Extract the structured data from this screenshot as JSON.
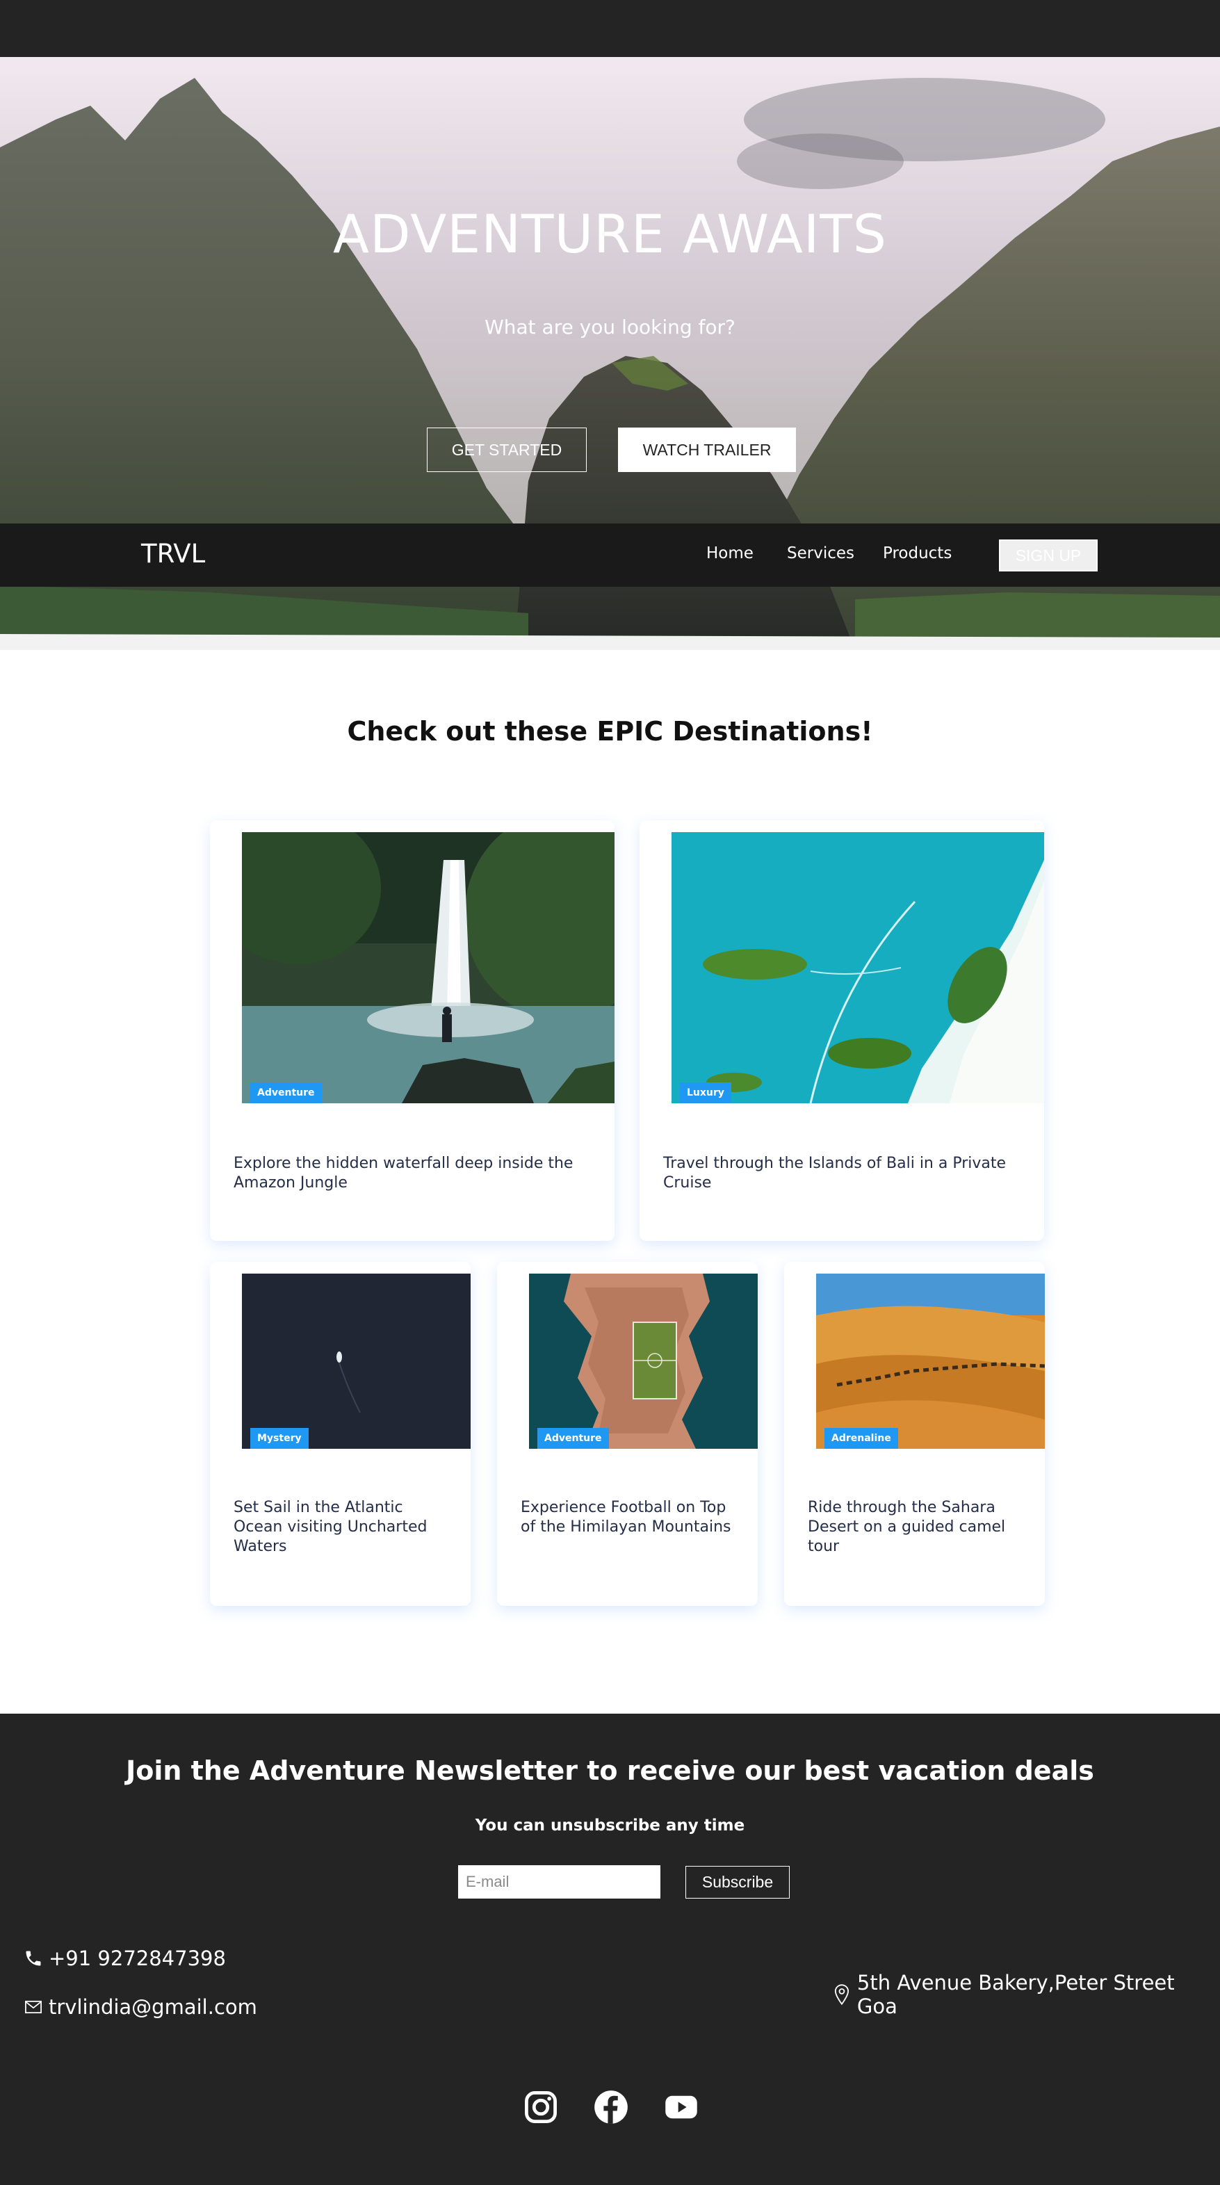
{
  "hero": {
    "title": "ADVENTURE AWAITS",
    "subtitle": "What are you looking for?",
    "primary_button": "GET STARTED",
    "secondary_button": "WATCH TRAILER"
  },
  "navbar": {
    "brand": "TRVL",
    "links": [
      "Home",
      "Services",
      "Products"
    ],
    "signup": "SIGN UP"
  },
  "destinations": {
    "title": "Check out these EPIC Destinations!",
    "cards": [
      {
        "tag": "Adventure",
        "text": "Explore the hidden waterfall deep inside the Amazon Jungle",
        "image": "waterfall-image"
      },
      {
        "tag": "Luxury",
        "text": "Travel through the Islands of Bali in a Private Cruise",
        "image": "bali-islands-image"
      },
      {
        "tag": "Mystery",
        "text": "Set Sail in the Atlantic Ocean visiting Uncharted Waters",
        "image": "ocean-boat-image"
      },
      {
        "tag": "Adventure",
        "text": "Experience Football on Top of the Himilayan Mountains",
        "image": "football-field-image"
      },
      {
        "tag": "Adrenaline",
        "text": "Ride through the Sahara Desert on a guided camel tour",
        "image": "desert-camels-image"
      }
    ]
  },
  "footer": {
    "newsletter_title": "Join the Adventure Newsletter to receive our best vacation deals",
    "newsletter_sub": "You can unsubscribe any time",
    "email_placeholder": "E-mail",
    "subscribe_button": "Subscribe",
    "phone": "+91 9272847398",
    "email": "trvlindia@gmail.com",
    "address": "5th Avenue Bakery,Peter Street Goa",
    "social_icons": [
      "instagram-icon",
      "facebook-icon",
      "youtube-icon"
    ]
  },
  "colors": {
    "dark_bg": "#242424",
    "navbar_bg": "#1b1a1a",
    "tag_blue": "#1f98f4",
    "card_text": "#252e48"
  }
}
